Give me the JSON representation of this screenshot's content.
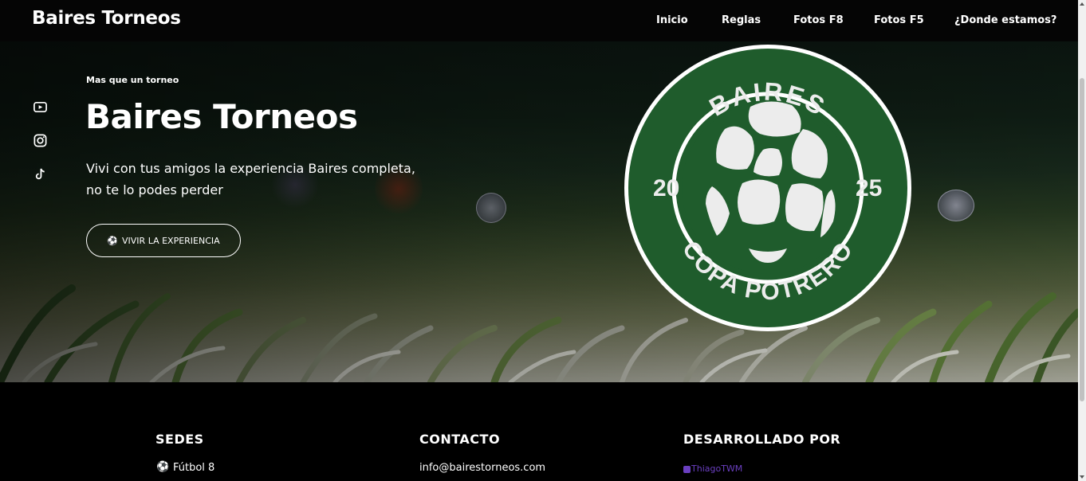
{
  "nav": {
    "brand": "Baires Torneos",
    "links": [
      "Inicio",
      "Reglas",
      "Fotos F8",
      "Fotos F5",
      "¿Donde estamos?"
    ]
  },
  "social": {
    "icons": [
      "youtube-icon",
      "instagram-icon",
      "tiktok-icon"
    ]
  },
  "hero": {
    "eyebrow": "Mas que un torneo",
    "title": "Baires Torneos",
    "subtitle_line1": "Vivi con tus amigos la experiencia Baires completa,",
    "subtitle_line2": "no te lo podes perder",
    "cta_label": "VIVIR LA EXPERIENCIA",
    "cta_icon": "soccer-ball-icon"
  },
  "logo": {
    "top_text": "BAIRES",
    "year_left": "20",
    "year_right": "25",
    "bottom_text": "COPA POTRERO",
    "green": "#1f5c2c",
    "ring": "#ffffff"
  },
  "footer": {
    "sedes_heading": "SEDES",
    "sede_1": "Fútbol 8",
    "contacto_heading": "CONTACTO",
    "email": "info@bairestorneos.com",
    "dev_heading": "DESARROLLADO POR",
    "dev_name": "ThiagoTWM",
    "dev_color": "#6a3fc0",
    "accent_green": "#2ea043"
  }
}
